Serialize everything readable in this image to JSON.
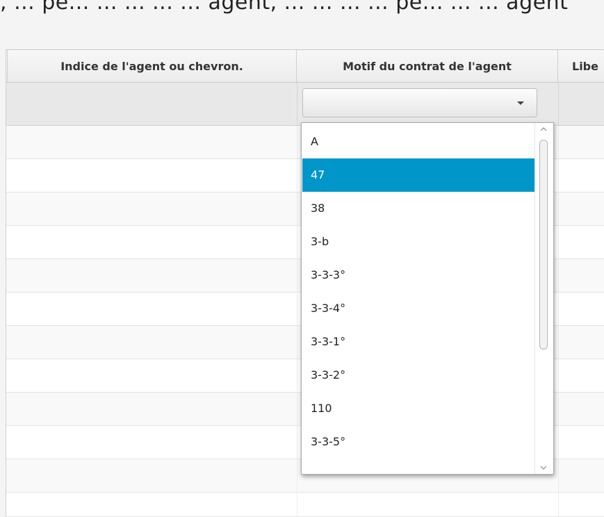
{
  "top_partial_text": ", ... pe... ... ... ... ... agent, ... ... ... ... pe... ... ... agent",
  "table": {
    "columns": [
      {
        "label": ""
      },
      {
        "label": "Indice de l'agent ou chevron."
      },
      {
        "label": "Motif du contrat de l'agent"
      },
      {
        "label": "Libe"
      }
    ]
  },
  "filter": {
    "selected_value": ""
  },
  "dropdown": {
    "options": [
      "A",
      "47",
      "38",
      "3-b",
      "3-3-3°",
      "3-3-4°",
      "3-3-1°",
      "3-3-2°",
      "110",
      "3-3-5°"
    ],
    "selected_index": 1,
    "scroll_position": 0.0,
    "selected_color": "#0096c9"
  },
  "icons": {
    "combo_arrow": "chevron-down-icon",
    "scroll_up": "chevron-up-icon",
    "scroll_down": "chevron-down-icon"
  }
}
